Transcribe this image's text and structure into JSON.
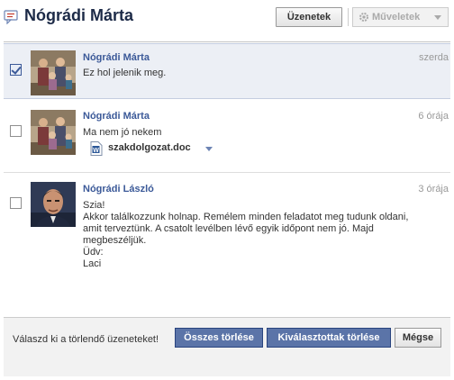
{
  "header": {
    "title": "Nógrádi Márta",
    "messages_button": "Üzenetek",
    "actions_button": "Műveletek"
  },
  "messages": [
    {
      "sender": "Nógrádi Márta",
      "time": "szerda",
      "text": "Ez hol jelenik meg.",
      "checked": true
    },
    {
      "sender": "Nógrádi Márta",
      "time": "6 órája",
      "text": "Ma nem jó nekem",
      "attachment": "szakdolgozat.doc",
      "checked": false
    },
    {
      "sender": "Nógrádi László",
      "time": "3 órája",
      "text": "Szia!\nAkkor találkozzunk holnap. Remélem minden feladatot meg tudunk oldani,\namit terveztünk. A csatolt levélben lévő egyik időpont nem jó. Majd\nmegbeszéljük.\nÜdv:\nLaci",
      "checked": false
    }
  ],
  "footer": {
    "prompt": "Válaszd ki a törlendő üzeneteket!",
    "delete_all": "Összes törlése",
    "delete_selected": "Kiválasztottak törlése",
    "cancel": "Mégse"
  },
  "colors": {
    "link": "#3b5998",
    "selected_row": "#eceff5",
    "primary_button": "#5b74a8"
  }
}
